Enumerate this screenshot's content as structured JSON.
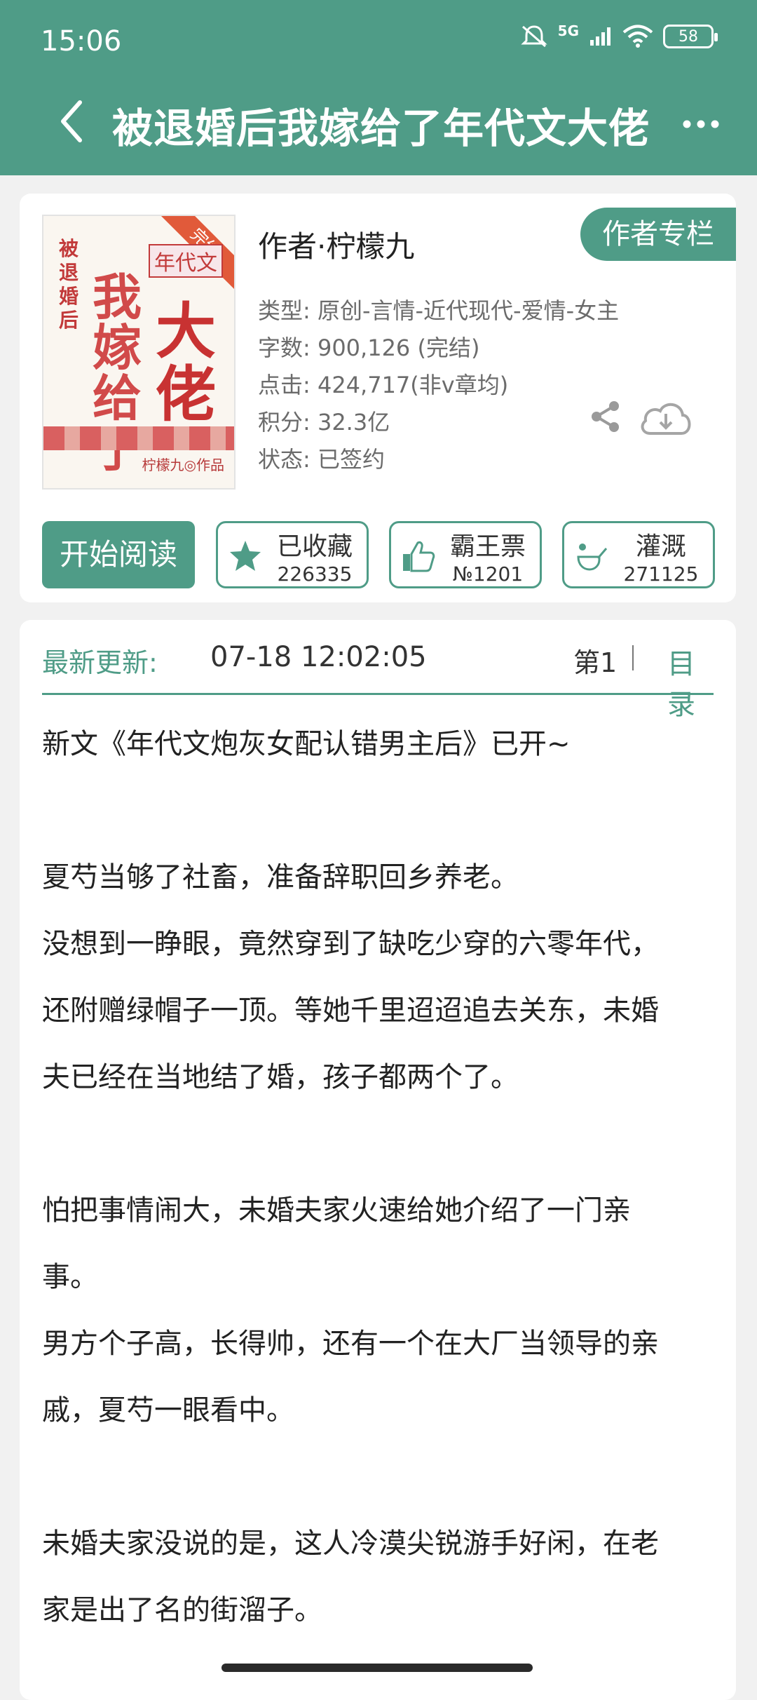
{
  "status_bar": {
    "time": "15:06",
    "network": "5G",
    "battery": "58"
  },
  "header": {
    "title": "被退婚后我嫁给了年代文大佬",
    "back_icon": "chevron-left-icon",
    "more_icon": "more-dots-icon"
  },
  "book": {
    "cover": {
      "title_small": "被退婚后",
      "title_big_1": "我嫁给了",
      "title_big_2": "大佬",
      "genre_label": "年代文",
      "status_tag": "完结",
      "author_mark": "柠檬九◎作品"
    },
    "author": "作者·柠檬九",
    "author_column_button": "作者专栏",
    "meta": [
      "类型: 原创-言情-近代现代-爱情-女主",
      "字数: 900,126 (完结)",
      "点击: 424,717(非v章均)",
      "积分: 32.3亿",
      "状态: 已签约"
    ]
  },
  "actions": {
    "read": "开始阅读",
    "favorite": {
      "label": "已收藏",
      "count": "226335"
    },
    "vote": {
      "label": "霸王票",
      "count": "№1201"
    },
    "water": {
      "label": "灌溉",
      "count": "271125"
    }
  },
  "update": {
    "label": "最新更新:",
    "time": "07-18 12:02:05",
    "chapter": "第1",
    "toc": "目录"
  },
  "intro": [
    "新文《年代文炮灰女配认错男主后》已开~",
    "",
    "夏芍当够了社畜，准备辞职回乡养老。",
    "没想到一睁眼，竟然穿到了缺吃少穿的六零年代，",
    "还附赠绿帽子一顶。等她千里迢迢追去关东，未婚",
    "夫已经在当地结了婚，孩子都两个了。",
    "",
    "怕把事情闹大，未婚夫家火速给她介绍了一门亲",
    "事。",
    "男方个子高，长得帅，还有一个在大厂当领导的亲",
    "戚，夏芍一眼看中。",
    "",
    "未婚夫家没说的是，这人冷漠尖锐游手好闲，在老",
    "家是出了名的街溜子。"
  ],
  "colors": {
    "brand": "#4f9c87",
    "cover_red": "#c83232"
  }
}
